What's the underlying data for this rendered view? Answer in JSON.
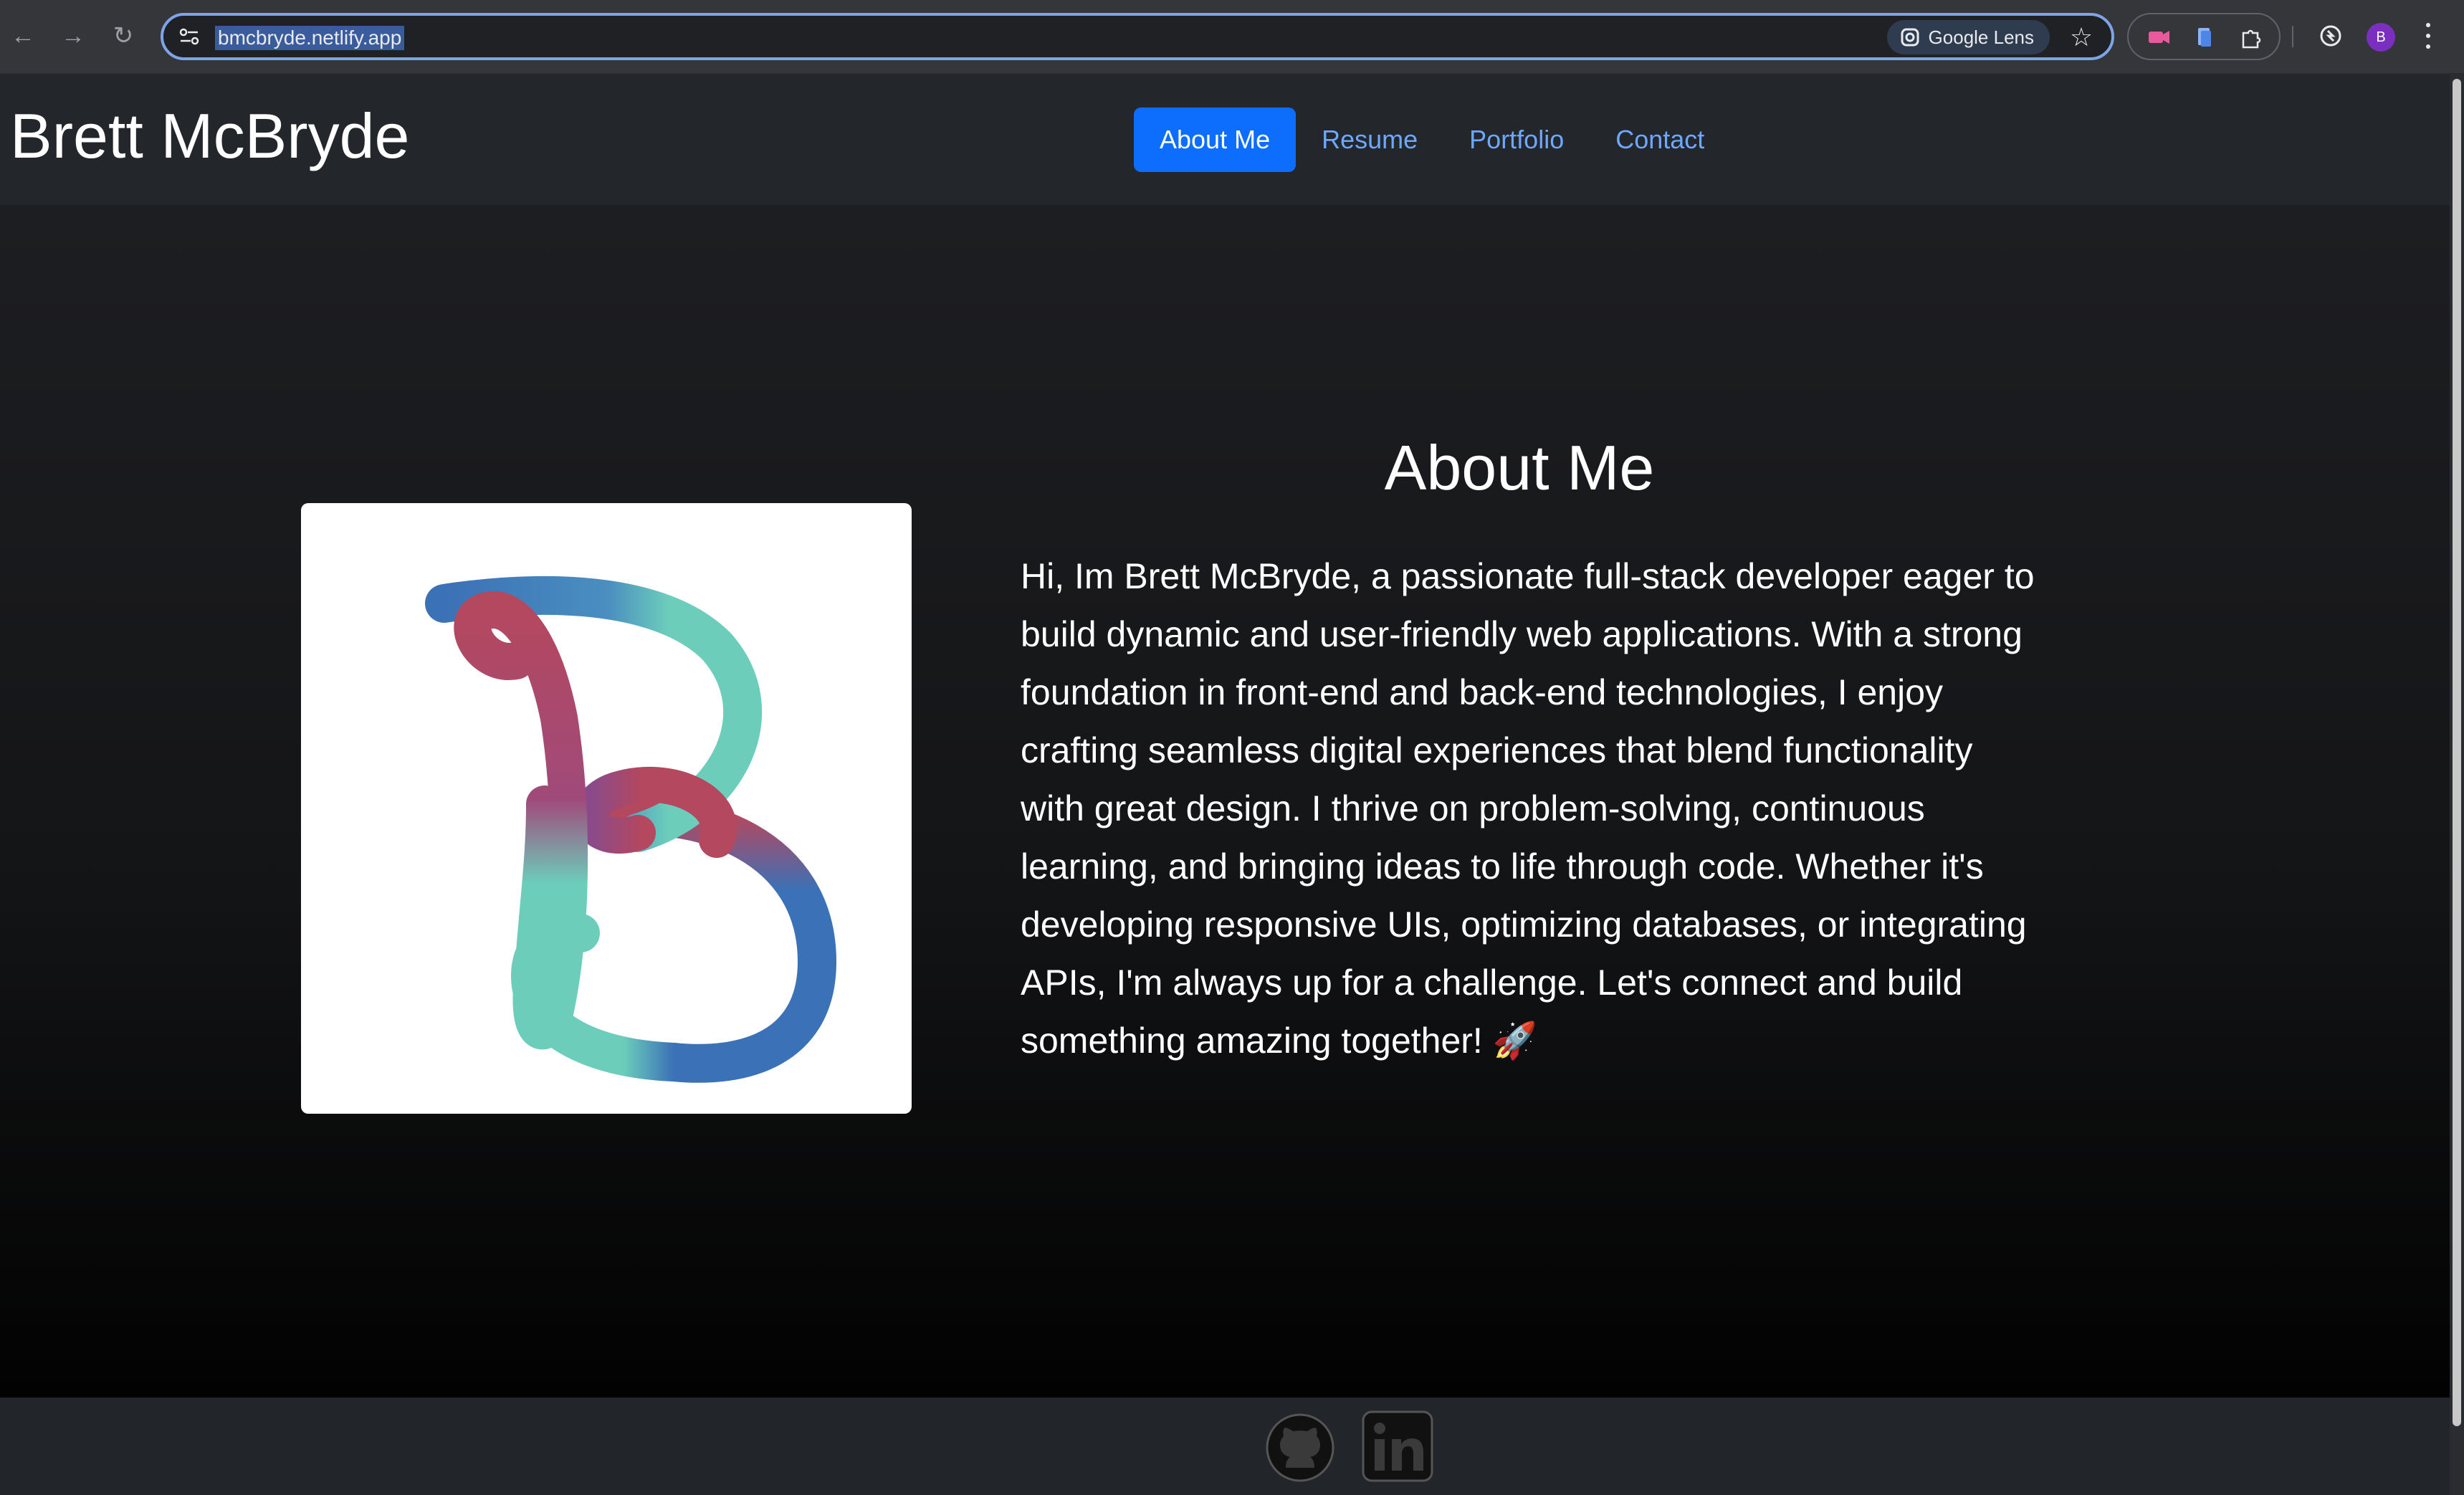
{
  "browser": {
    "url": "bmcbryde.netlify.app",
    "lens_label": "Google Lens",
    "profile_initial": "B"
  },
  "header": {
    "site_title": "Brett McBryde",
    "nav": [
      {
        "label": "About Me",
        "active": true
      },
      {
        "label": "Resume",
        "active": false
      },
      {
        "label": "Portfolio",
        "active": false
      },
      {
        "label": "Contact",
        "active": false
      }
    ]
  },
  "about": {
    "heading": "About Me",
    "body": "Hi, Im Brett McBryde, a passionate full-stack developer eager to build dynamic and user-friendly web applications. With a strong foundation in front-end and back-end technologies, I enjoy crafting seamless digital experiences that blend functionality with great design. I thrive on problem-solving, continuous learning, and bringing ideas to life through code. Whether it's developing responsive UIs, optimizing databases, or integrating APIs, I'm always up for a challenge. Let's connect and build something amazing together! 🚀"
  },
  "icons": {
    "logo": "b-monogram-logo",
    "footer": [
      "github-icon",
      "linkedin-icon"
    ]
  },
  "colors": {
    "accent": "#0d6efd",
    "link": "#6ea8fe",
    "logo_teal": "#6ccdbb",
    "logo_blue": "#3b71b6",
    "logo_red": "#b4485f"
  }
}
